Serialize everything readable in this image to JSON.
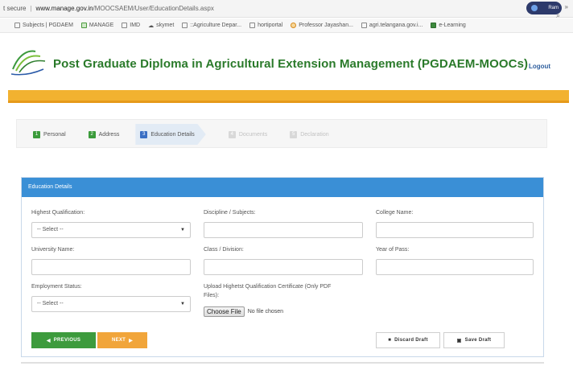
{
  "browser": {
    "security_label": "t secure",
    "url_host": "www.manage.gov.in",
    "url_path": "/MOOCSAEM/User/EducationDetails.aspx",
    "profile_label": "Ram"
  },
  "bookmarks": [
    {
      "label": "Subjects | PGDAEM",
      "icon": "page-icon"
    },
    {
      "label": "MANAGE",
      "icon": "globe-icon"
    },
    {
      "label": "IMD",
      "icon": "page-icon"
    },
    {
      "label": "skymet",
      "icon": "cloud-icon"
    },
    {
      "label": "::Agriculture Depar...",
      "icon": "page-icon"
    },
    {
      "label": "hortiportal",
      "icon": "page-icon"
    },
    {
      "label": "Professor Jayashan...",
      "icon": "orange-circle-icon"
    },
    {
      "label": "agri.telangana.gov.i...",
      "icon": "page-icon"
    },
    {
      "label": "e-Learning",
      "icon": "bookmark-green-icon"
    }
  ],
  "header": {
    "title": "Post Graduate Diploma in Agricultural Extension Management (PGDAEM-MOOCs)",
    "logout": "Logout"
  },
  "steps": [
    {
      "num": "1",
      "label": "Personal",
      "state": "done"
    },
    {
      "num": "2",
      "label": "Address",
      "state": "done"
    },
    {
      "num": "3",
      "label": "Education Details",
      "state": "active"
    },
    {
      "num": "4",
      "label": "Documents",
      "state": "pending"
    },
    {
      "num": "5",
      "label": "Declaration",
      "state": "pending"
    }
  ],
  "panel": {
    "heading": "Education Details",
    "fields": {
      "highest_qualification": {
        "label": "Highest Qualification:",
        "value": "-- Select --"
      },
      "discipline": {
        "label": "Discipline / Subjects:"
      },
      "college": {
        "label": "College Name:"
      },
      "university": {
        "label": "University Name:"
      },
      "class_division": {
        "label": "Class / Division:"
      },
      "year_of_pass": {
        "label": "Year of Pass:"
      },
      "employment_status": {
        "label": "Employment Status:",
        "value": "-- Select --"
      },
      "upload": {
        "label_line1": "Upload Highetst Qualification Certificate (Only PDF",
        "label_line2": "Files):",
        "button": "Choose File",
        "status": "No file chosen"
      }
    },
    "buttons": {
      "previous": "PREVIOUS",
      "next": "NEXT",
      "discard": "Discard Draft",
      "save": "Save Draft"
    }
  },
  "colors": {
    "title_green": "#2a7a2a",
    "orange_bar": "#f2b230",
    "panel_blue": "#3a8fd6",
    "step_green": "#3b9b3b",
    "step_blue": "#3a6fc4"
  }
}
